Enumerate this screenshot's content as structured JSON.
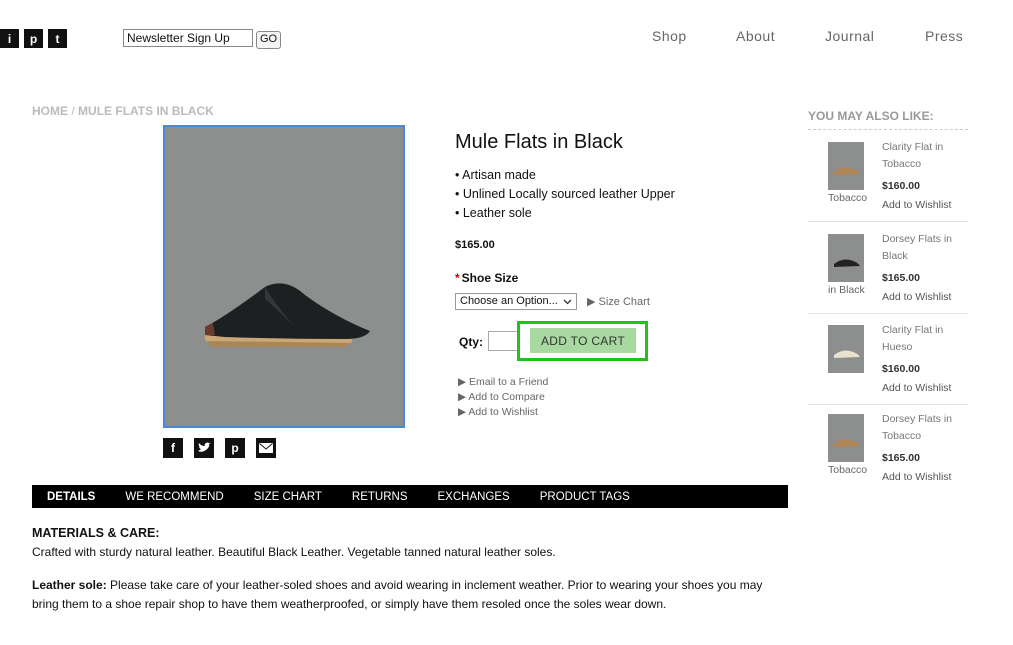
{
  "header": {
    "social": [
      "i",
      "p",
      "t"
    ],
    "newsletter_value": "Newsletter Sign Up",
    "go_label": "GO",
    "nav": [
      "Shop",
      "About",
      "Journal",
      "Press"
    ]
  },
  "breadcrumb": {
    "home": "HOME",
    "sep": "/",
    "current": "MULE FLATS IN BLACK"
  },
  "product": {
    "title": "Mule Flats in Black",
    "bullets": [
      "• Artisan made",
      "• Unlined Locally sourced leather Upper",
      "• Leather sole"
    ],
    "price": "$165.00",
    "size_required": "*",
    "size_label": "Shoe Size",
    "size_placeholder": "Choose an Option...",
    "size_chart": "Size Chart",
    "qty_label": "Qty:",
    "add_to_cart": "ADD TO CART",
    "links": [
      "Email to a Friend",
      "Add to Compare",
      "Add to Wishlist"
    ],
    "share_icons": [
      "facebook-icon",
      "twitter-icon",
      "pinterest-icon",
      "email-icon"
    ]
  },
  "tabs": [
    "DETAILS",
    "WE RECOMMEND",
    "SIZE CHART",
    "RETURNS",
    "EXCHANGES",
    "PRODUCT TAGS"
  ],
  "details": {
    "heading": "MATERIALS & CARE:",
    "care_text": "Crafted with sturdy natural leather. Beautiful Black Leather. Vegetable tanned natural leather soles.",
    "sole_label": "Leather sole:",
    "sole_text": " Please take care of your leather-soled shoes and avoid wearing in inclement weather. Prior to wearing your shoes you may bring them to a shoe repair shop to have them weatherproofed, or simply have them resoled once the soles wear down."
  },
  "sidebar": {
    "heading": "YOU MAY ALSO LIKE:",
    "items": [
      {
        "name": "Clarity Flat in Tobacco",
        "caption": "Tobacco",
        "price": "$160.00",
        "wishlist": "Add to Wishlist"
      },
      {
        "name": "Dorsey Flats in Black",
        "caption": "in Black",
        "price": "$165.00",
        "wishlist": "Add to Wishlist"
      },
      {
        "name": "Clarity Flat in Hueso",
        "caption": "",
        "price": "$160.00",
        "wishlist": "Add to Wishlist"
      },
      {
        "name": "Dorsey Flats in Tobacco",
        "caption": "Tobacco",
        "price": "$165.00",
        "wishlist": "Add to Wishlist"
      }
    ]
  },
  "colors": {
    "cart_button": "#a8d9a0",
    "cart_highlight": "#21c21c",
    "image_border": "#4a8ad4",
    "tab_bar": "#000000"
  }
}
